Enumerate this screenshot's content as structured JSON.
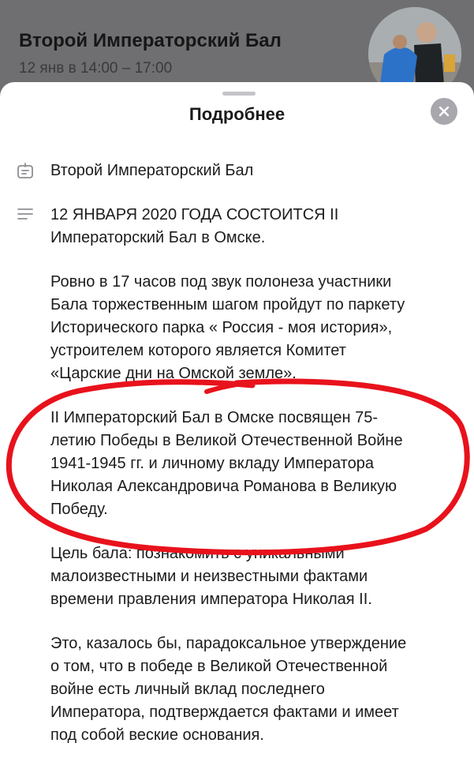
{
  "event": {
    "title": "Второй Императорский Бал",
    "date": "12 янв в 14:00 – 17:00"
  },
  "sheet": {
    "title": "Подробнее",
    "name": "Второй Императорский Бал",
    "paragraphs": [
      "12 ЯНВАРЯ 2020 ГОДА СОСТОИТСЯ II\nИмператорский Бал в Омске.",
      "Ровно в 17 часов под звук полонеза участники\nБала торжественным шагом пройдут по паркету\nИсторического парка « Россия - моя история»,\nустроителем которого является  Комитет\n«Царские дни на Омской земле».",
      "II Императорский Бал в Омске посвящен 75-\nлетию Победы в Великой Отечественной Войне\n1941-1945 гг. и личному вкладу Императора\nНиколая Александровича Романова в Великую\nПобеду.",
      "Цель бала: познакомить с уникальными\nмалоизвестными и неизвестными фактами\nвремени правления императора Николая II.",
      "Это, казалось бы, парадоксальное утверждение\nо том, что в победе в Великой Отечественной\nвойне есть личный вклад последнего\nИмператора, подтверждается фактами и имеет\nпод собой веские основания."
    ]
  },
  "icons": {
    "close": "close-icon",
    "name_row": "calendar-tag-icon",
    "description_row": "text-lines-icon"
  },
  "colors": {
    "highlight_ring": "#e8121c",
    "close_button": "#a7a7ad",
    "overlay": "#6f6f72"
  }
}
